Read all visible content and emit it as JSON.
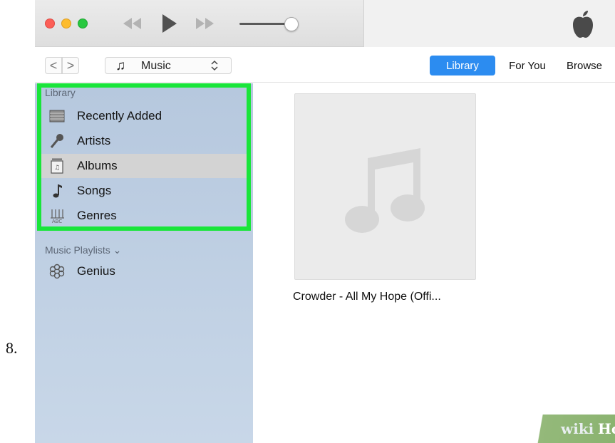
{
  "step": {
    "number": "8."
  },
  "player": {
    "controls": [
      "rewind-icon",
      "play-icon",
      "fast-forward-icon"
    ],
    "volume_level": 0.85
  },
  "nav": {
    "back": "<",
    "forward": ">",
    "source": {
      "selected": "Music",
      "icon": "music-note-icon",
      "updown": "⌃⌄"
    },
    "tabs": [
      {
        "label": "Library",
        "active": true
      },
      {
        "label": "For You",
        "active": false
      },
      {
        "label": "Browse",
        "active": false
      }
    ]
  },
  "sidebar": {
    "library_header": "Library",
    "items": [
      {
        "label": "Recently Added",
        "icon": "grid-icon"
      },
      {
        "label": "Artists",
        "icon": "microphone-icon"
      },
      {
        "label": "Albums",
        "icon": "album-icon",
        "selected": true
      },
      {
        "label": "Songs",
        "icon": "music-note-icon"
      },
      {
        "label": "Genres",
        "icon": "genres-icon"
      }
    ],
    "playlists_header": "Music Playlists ⌄",
    "playlists": [
      {
        "label": "Genius",
        "icon": "genius-icon"
      }
    ]
  },
  "main": {
    "albums": [
      {
        "title": "Crowder - All My Hope (Offi..."
      }
    ]
  },
  "watermark": {
    "wiki": "wiki",
    "how": "How"
  },
  "colors": {
    "highlight": "#19e53a",
    "accent": "#2c8cf0",
    "sidebar": "#b6c8de"
  }
}
